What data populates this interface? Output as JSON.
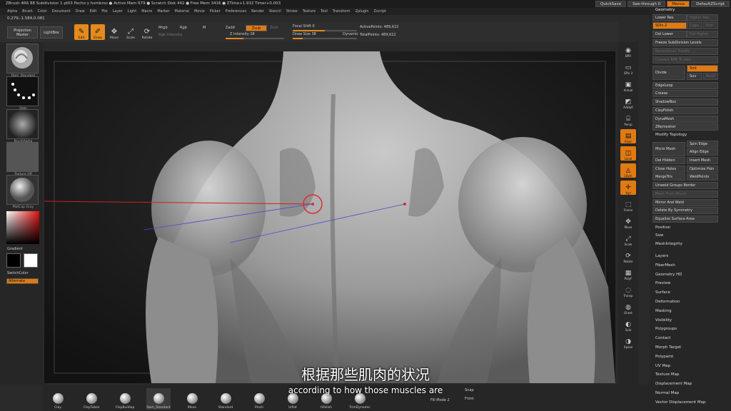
{
  "titlebar": {
    "text": "ZBrush 4R6    88 Subdivision 1 pt03 Pecho y hombros  ● Active Mem 679 ● Scratch Disk 442 ● Free Mem 3416 ● ZTime+1.932 Timer+0.003",
    "quicksave": "QuickSave",
    "seethrough": "See-through 0",
    "menus": "Menus",
    "default_script": "DefaultZScript"
  },
  "menubar": [
    "Alpha",
    "Brush",
    "Color",
    "Document",
    "Draw",
    "Edit",
    "File",
    "Layer",
    "Light",
    "Macro",
    "Marker",
    "Material",
    "Movie",
    "Picker",
    "Preferences",
    "Render",
    "Stencil",
    "Stroke",
    "Texture",
    "Tool",
    "Transform",
    "Zplugin",
    "Zscript"
  ],
  "coords": "0.279,-1.584,0.081",
  "toolbar": {
    "projection_master": "Projection Master",
    "lightbox": "LightBox",
    "edit": "Edit",
    "draw": "Draw",
    "move": "Move",
    "scale": "Scale",
    "rotate": "Rotate",
    "mrgb": "Mrgb",
    "rgb": "Rgb",
    "m": "M",
    "zadd": "Zadd",
    "zsub": "Zsub",
    "zcut": "Zcut",
    "rgb_intensity": "Rgb Intensity",
    "z_intensity": "Z Intensity 28",
    "focal_shift": "Focal Shift 0",
    "draw_size": "Draw Size 38",
    "dynamic": "Dynamic",
    "active_points": "ActivePoints: 489,622",
    "total_points": "TotalPoints: 489,622"
  },
  "left_shelf": {
    "brushes": [
      "Dam_Standard",
      "Dots",
      "BrushAlpha",
      "Texture Off",
      "MatCap Gray"
    ],
    "gradient": "Gradient",
    "switch_color": "SwitchColor",
    "alternate": "Alternate"
  },
  "right_shelf": [
    "BPR",
    "SPix 3",
    "Actual",
    "AAHalf",
    "Persp",
    "Floor",
    "Local",
    "LSym",
    "Xyz",
    "Frame",
    "Move",
    "Scale",
    "Rotate",
    "PolyF",
    "Transp",
    "Ghost",
    "Solo",
    "Xpose"
  ],
  "right_panel": {
    "geometry_header": "Geometry",
    "lower_res": "Lower Res",
    "higher_res": "Higher Res",
    "sdiv": "SDiv 2",
    "cage": "Cage",
    "rstr": "Rstr",
    "del_lower": "Del Lower",
    "del_higher": "Del Higher",
    "freeze": "Freeze SubDivision Levels",
    "reconstruct": "Reconstruct Subdiv",
    "convert_bpr": "Convert BPR To Geo",
    "divide": "Divide",
    "smt": "Smt",
    "suv": "Suv",
    "reuv": "ReUV",
    "edgeloop": "EdgeLoop",
    "crease": "Crease",
    "shadowbox": "ShadowBox",
    "claypolish": "ClayPolish",
    "dynamesh": "DynaMesh",
    "zremesher": "ZRemesher",
    "modify_topology": "Modify Topology",
    "micro_mesh": "Micro Mesh",
    "spin_edge": "Spin Edge",
    "align_edge": "Align Edge",
    "del_hidden": "Del Hidden",
    "insert_mesh": "Insert Mesh",
    "close_holes": "Close Holes",
    "optimize_points": "Optimize Poin",
    "mergetris": "MergeTris",
    "weldpoints": "WeldPoints",
    "unweld": "Unweld Groups Border",
    "mesh_from_brush": "Mesh From Brush",
    "mirror_weld": "Mirror And Weld",
    "delete_symmetry": "Delete By Symmetry",
    "equalize": "Equalize Surface Area",
    "position": "Position",
    "size": "Size",
    "meshintegrity": "MeshIntegrity",
    "subpalettes": [
      "Layers",
      "FiberMesh",
      "Geometry HD",
      "Preview",
      "Surface",
      "Deformation",
      "Masking",
      "Visibility",
      "Polygroups",
      "Contact",
      "Morph Target",
      "Polypaint",
      "UV Map",
      "Texture Map",
      "Displacement Map",
      "Normal Map",
      "Vector Displacement Map"
    ]
  },
  "bottom_bar": {
    "brushes": [
      "Clay",
      "ClayTubes",
      "ClayBuildup",
      "Dam_Standard",
      "Move",
      "Standard",
      "Pinch",
      "Inflat",
      "hPolish",
      "TrimDynamic"
    ],
    "fill_mode": "Fill Mode 2",
    "snap": "Snap",
    "front": "Front"
  },
  "subtitles": {
    "chinese": "根据那些肌肉的状况",
    "english": "according to how those muscles are"
  }
}
